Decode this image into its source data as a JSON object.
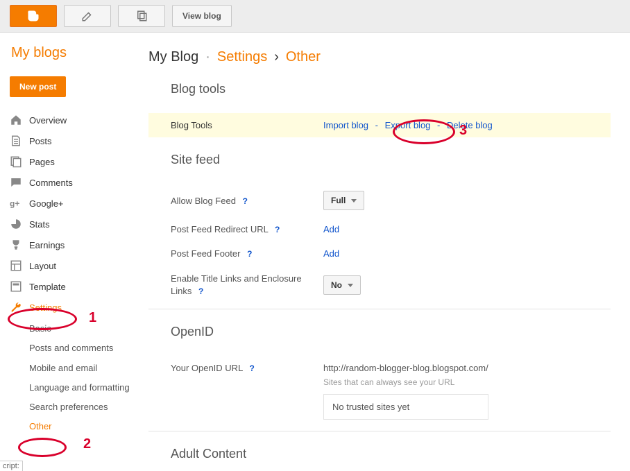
{
  "topbar": {
    "view_blog_label": "View blog"
  },
  "sidebar": {
    "heading": "My blogs",
    "new_post_label": "New post",
    "items": [
      "Overview",
      "Posts",
      "Pages",
      "Comments",
      "Google+",
      "Stats",
      "Earnings",
      "Layout",
      "Template",
      "Settings"
    ],
    "settings_children": [
      "Basic",
      "Posts and comments",
      "Mobile and email",
      "Language and formatting",
      "Search preferences",
      "Other"
    ]
  },
  "breadcrumb": {
    "blog": "My Blog",
    "section": "Settings",
    "page": "Other",
    "sep1": "·",
    "sep2": "›"
  },
  "sections": {
    "blog_tools": {
      "title": "Blog tools",
      "row_label": "Blog Tools",
      "import": "Import blog",
      "export": "Export blog",
      "delete": "Delete blog",
      "dash": "-"
    },
    "site_feed": {
      "title": "Site feed",
      "allow_label": "Allow Blog Feed",
      "allow_value": "Full",
      "redirect_label": "Post Feed Redirect URL",
      "redirect_action": "Add",
      "footer_label": "Post Feed Footer",
      "footer_action": "Add",
      "title_links_label": "Enable Title Links and Enclosure Links",
      "title_links_value": "No"
    },
    "openid": {
      "title": "OpenID",
      "url_label": "Your OpenID URL",
      "url_value": "http://random-blogger-blog.blogspot.com/",
      "caption": "Sites that can always see your URL",
      "trusted_empty": "No trusted sites yet"
    },
    "adult": {
      "title": "Adult Content"
    }
  },
  "annotations": {
    "n1": "1",
    "n2": "2",
    "n3": "3"
  },
  "footer_script_fragment": "cript:"
}
